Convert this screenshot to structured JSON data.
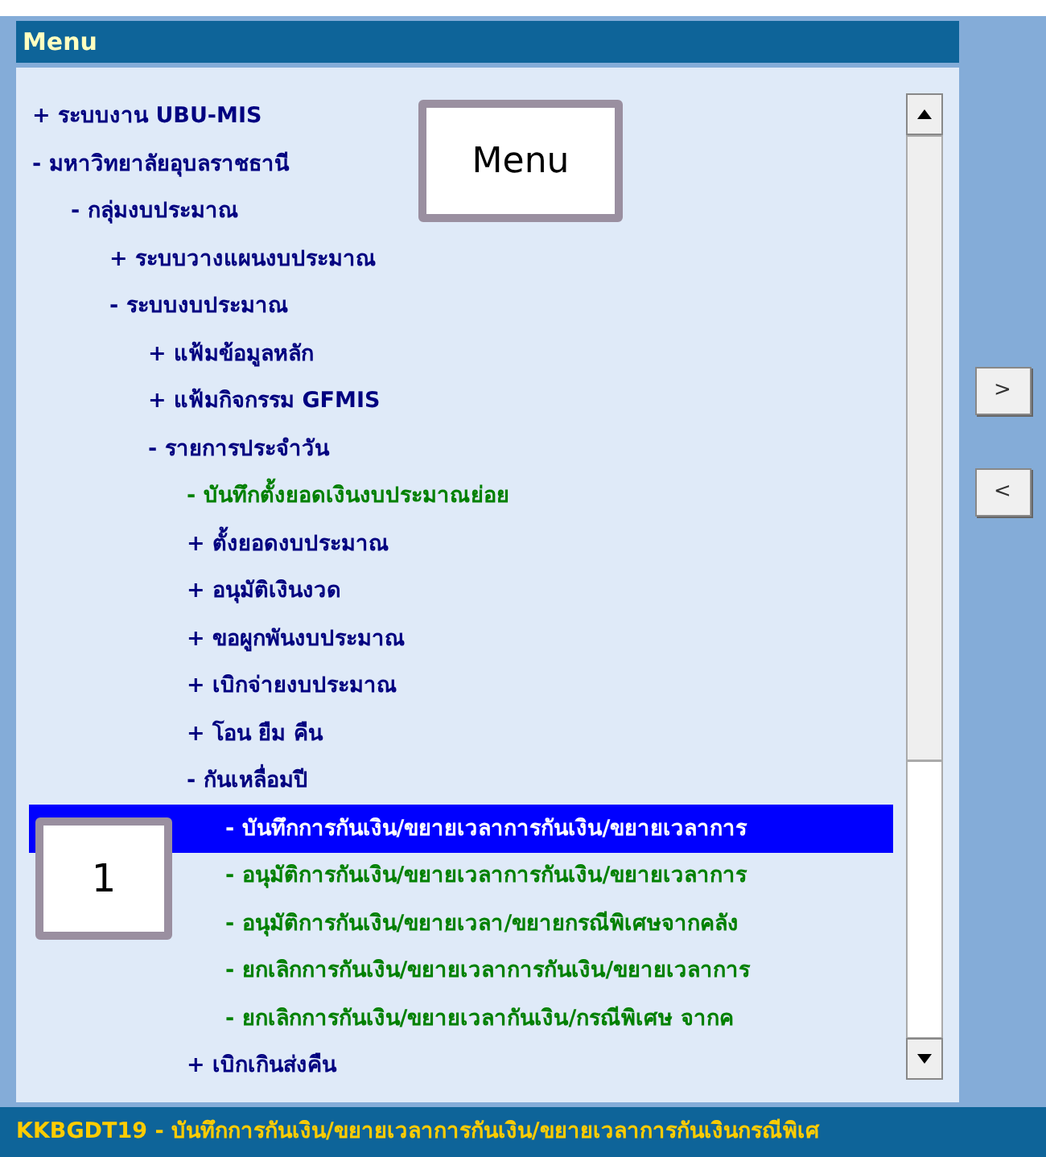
{
  "panel": {
    "title": "Menu"
  },
  "tree": [
    {
      "label": "+ ระบบงาน UBU-MIS",
      "kind": "node",
      "selected": false
    },
    {
      "label": "- มหาวิทยาลัยอุบลราชธานี",
      "kind": "node",
      "selected": false,
      "children": [
        {
          "label": "- กลุ่มงบประมาณ",
          "kind": "node",
          "selected": false,
          "children": [
            {
              "label": "+ ระบบวางแผนงบประมาณ",
              "kind": "node",
              "selected": false
            },
            {
              "label": "- ระบบงบประมาณ",
              "kind": "node",
              "selected": false,
              "children": [
                {
                  "label": "+ แฟ้มข้อมูลหลัก",
                  "kind": "node",
                  "selected": false
                },
                {
                  "label": "+ แฟ้มกิจกรรม GFMIS",
                  "kind": "node",
                  "selected": false
                },
                {
                  "label": "- รายการประจำวัน",
                  "kind": "node",
                  "selected": false,
                  "children": [
                    {
                      "label": "- บันทึกตั้งยอดเงินงบประมาณย่อย",
                      "kind": "leaf",
                      "selected": false
                    },
                    {
                      "label": "+ ตั้งยอดงบประมาณ",
                      "kind": "node",
                      "selected": false
                    },
                    {
                      "label": "+ อนุมัติเงินงวด",
                      "kind": "node",
                      "selected": false
                    },
                    {
                      "label": "+ ขอผูกพันงบประมาณ",
                      "kind": "node",
                      "selected": false
                    },
                    {
                      "label": "+ เบิกจ่ายงบประมาณ",
                      "kind": "node",
                      "selected": false
                    },
                    {
                      "label": "+ โอน ยืม คืน",
                      "kind": "node",
                      "selected": false
                    },
                    {
                      "label": "- กันเหลื่อมปี",
                      "kind": "node",
                      "selected": false,
                      "children": [
                        {
                          "label": "- บันทึกการกันเงิน/ขยายเวลาการกันเงิน/ขยายเวลาการ",
                          "kind": "leaf",
                          "selected": true
                        },
                        {
                          "label": "- อนุมัติการกันเงิน/ขยายเวลาการกันเงิน/ขยายเวลาการ",
                          "kind": "leaf",
                          "selected": false
                        },
                        {
                          "label": "- อนุมัติการกันเงิน/ขยายเวลา/ขยายกรณีพิเศษจากคลัง",
                          "kind": "leaf",
                          "selected": false
                        },
                        {
                          "label": "- ยกเลิกการกันเงิน/ขยายเวลาการกันเงิน/ขยายเวลาการ",
                          "kind": "leaf",
                          "selected": false
                        },
                        {
                          "label": "- ยกเลิกการกันเงิน/ขยายเวลากันเงิน/กรณีพิเศษ จากค",
                          "kind": "leaf",
                          "selected": false
                        }
                      ]
                    },
                    {
                      "label": "+ เบิกเกินส่งคืน",
                      "kind": "node",
                      "selected": false
                    }
                  ]
                }
              ]
            }
          ]
        }
      ]
    }
  ],
  "nav_buttons": [
    ">",
    "<"
  ],
  "status_bar": "KKBGDT19 - บันทึกการกันเงิน/ขยายเวลาการกันเงิน/ขยายเวลาการกันเงินกรณีพิเศ",
  "annotations": [
    {
      "label": "Menu"
    },
    {
      "label": "1"
    }
  ]
}
